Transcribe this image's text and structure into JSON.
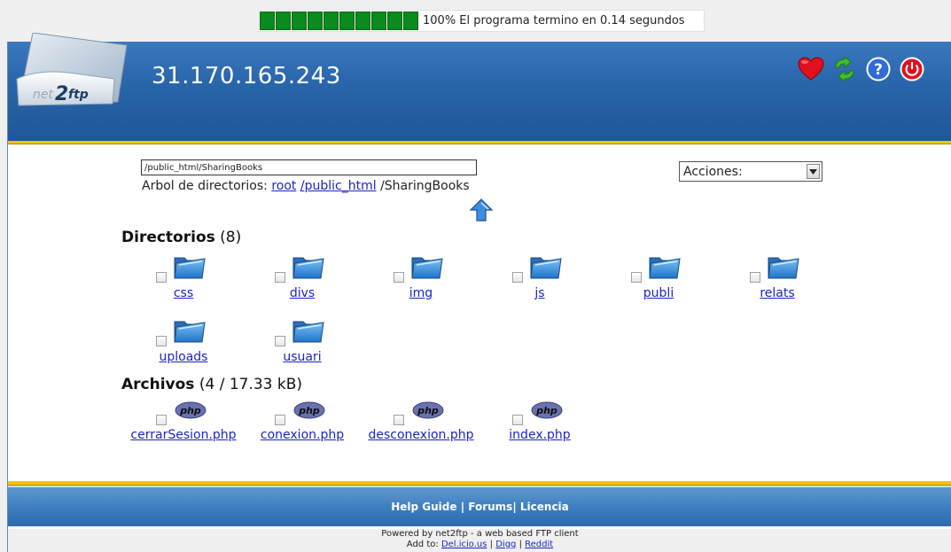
{
  "progress": {
    "percent": 100,
    "text": "100% El programa termino en 0.14 segundos"
  },
  "header": {
    "logo_text": "net2ftp",
    "host": "31.170.165.243",
    "icons": [
      "bookmark-heart-icon",
      "refresh-icon",
      "help-icon",
      "logout-icon"
    ]
  },
  "nav": {
    "directory_value": "/public_html/SharingBooks",
    "breadcrumb_label": "Arbol de directorios:",
    "crumbs": [
      "root",
      "/public_html",
      "/SharingBooks"
    ],
    "actions_label": "Acciones:"
  },
  "directories": {
    "title": "Directorios",
    "count": "(8)",
    "items": [
      "css",
      "divs",
      "img",
      "js",
      "publi",
      "relats",
      "uploads",
      "usuari"
    ]
  },
  "files": {
    "title": "Archivos",
    "count": "(4 / 17.33 kB)",
    "badge": "php",
    "items": [
      "cerrarSesion.php",
      "conexion.php",
      "desconexion.php",
      "index.php"
    ]
  },
  "footer": {
    "links": [
      "Help Guide",
      "Forums",
      "Licencia"
    ],
    "powered": "Powered by net2ftp - a web based FTP client",
    "add_to": "Add to:",
    "add_links": [
      "Del.icio.us",
      "Digg",
      "Reddit"
    ]
  },
  "colors": {
    "header_blue": "#2a66ab",
    "stripe_yellow": "#f5c400",
    "link_blue": "#1a24c4",
    "progress_green": "#0b8a1e"
  }
}
